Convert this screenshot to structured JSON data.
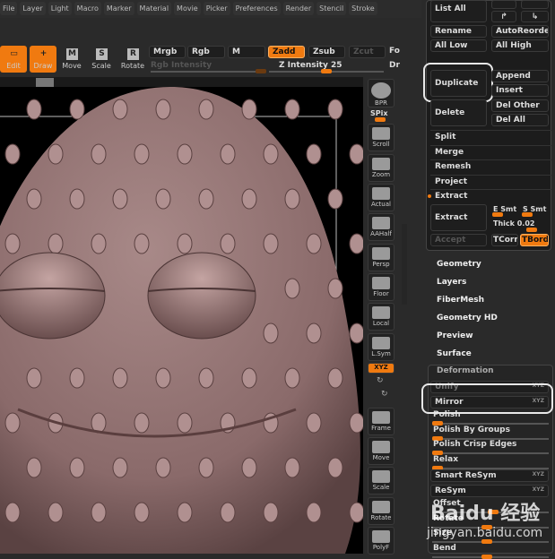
{
  "menu": [
    "File",
    "Layer",
    "Light",
    "Macro",
    "Marker",
    "Material",
    "Movie",
    "Picker",
    "Preferences",
    "Render",
    "Stencil",
    "Stroke"
  ],
  "tools": {
    "edit": "Edit",
    "draw": "Draw",
    "move": "Move",
    "scale": "Scale",
    "rotate": "Rotate",
    "move_key": "M",
    "scale_key": "S",
    "rotate_key": "R"
  },
  "modes": {
    "mrgb": "Mrgb",
    "rgb": "Rgb",
    "m": "M",
    "zadd": "Zadd",
    "zsub": "Zsub",
    "zcut": "Zcut",
    "fo": "Fo",
    "dr": "Dr"
  },
  "sliders": {
    "rgb_intensity": "Rgb Intensity",
    "z_intensity": "Z Intensity 25",
    "z_intensity_value": 25
  },
  "right_toolbar": [
    "BPR",
    "SPix",
    "Scroll",
    "Zoom",
    "Actual",
    "AAHalf",
    "Persp",
    "Floor",
    "Local",
    "L.Sym",
    "XYZ",
    "Frame",
    "Move",
    "Scale",
    "Rotate",
    "PolyF"
  ],
  "subtool": {
    "list_all": "List All",
    "rename": "Rename",
    "auto_reorder": "AutoReorder",
    "all_low": "All Low",
    "all_high": "All High",
    "duplicate": "Duplicate",
    "append": "Append",
    "insert": "Insert",
    "delete": "Delete",
    "del_other": "Del Other",
    "del_all": "Del All",
    "split": "Split",
    "merge": "Merge",
    "remesh": "Remesh",
    "project": "Project",
    "extract_head": "Extract",
    "extract": "Extract",
    "e_smt": "E Smt",
    "s_smt": "S Smt",
    "thick": "Thick 0.02",
    "accept": "Accept",
    "tcorn": "TCorn",
    "tbord": "TBord"
  },
  "tool_sections": [
    "Geometry",
    "Layers",
    "FiberMesh",
    "Geometry HD",
    "Preview",
    "Surface"
  ],
  "deformation": {
    "title": "Deformation",
    "items": [
      "Unify",
      "Mirror",
      "Polish",
      "Polish By Groups",
      "Polish Crisp Edges",
      "Relax",
      "Smart ReSym",
      "ReSym",
      "Offset",
      "Rotate",
      "Size",
      "Bend"
    ],
    "xyz": "XYZ"
  },
  "watermark": {
    "brand": "Baidu 经验",
    "url": "jingyan.baidu.com"
  }
}
